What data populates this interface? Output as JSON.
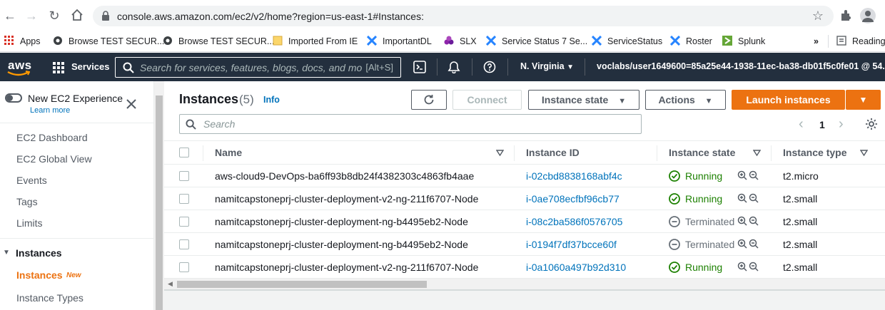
{
  "browser": {
    "url": "console.aws.amazon.com/ec2/v2/home?region=us-east-1#Instances:",
    "bookmarks": [
      "Apps",
      "Browse TEST SECUR...",
      "Browse TEST SECUR...",
      "Imported From IE",
      "ImportantDL",
      "SLX",
      "Service Status 7 Se...",
      "ServiceStatus",
      "Roster",
      "Splunk"
    ],
    "overflow": "»",
    "reading_list": "Reading"
  },
  "aws_header": {
    "logo": "aws",
    "services": "Services",
    "search_placeholder": "Search for services, features, blogs, docs, and mo",
    "search_shortcut": "[Alt+S]",
    "region": "N. Virginia",
    "account": "voclabs/user1649600=85a25e44-1938-11ec-ba38-db01f5c0fe01 @ 54..."
  },
  "sidebar": {
    "toggle_label": "New EC2 Experience",
    "learn_more": "Learn more",
    "items": [
      "EC2 Dashboard",
      "EC2 Global View",
      "Events",
      "Tags",
      "Limits"
    ],
    "section": "Instances",
    "active_item": "Instances",
    "new_badge": "New",
    "next_item": "Instance Types"
  },
  "instances_panel": {
    "title": "Instances",
    "count": "(5)",
    "info": "Info",
    "connect": "Connect",
    "instance_state": "Instance state",
    "actions": "Actions",
    "launch": "Launch instances",
    "search_placeholder": "Search",
    "page": "1",
    "columns": [
      "Name",
      "Instance ID",
      "Instance state",
      "Instance type"
    ],
    "rows": [
      {
        "name": "aws-cloud9-DevOps-ba6ff93b8db24f4382303c4863fb4aae",
        "id": "i-02cbd8838168abf4c",
        "state": "Running",
        "type": "t2.micro"
      },
      {
        "name": "namitcapstoneprj-cluster-deployment-v2-ng-211f6707-Node",
        "id": "i-0ae708ecfbf96cb77",
        "state": "Running",
        "type": "t2.small"
      },
      {
        "name": "namitcapstoneprj-cluster-deployment-ng-b4495eb2-Node",
        "id": "i-08c2ba586f0576705",
        "state": "Terminated",
        "type": "t2.small"
      },
      {
        "name": "namitcapstoneprj-cluster-deployment-ng-b4495eb2-Node",
        "id": "i-0194f7df37bcce60f",
        "state": "Terminated",
        "type": "t2.small"
      },
      {
        "name": "namitcapstoneprj-cluster-deployment-v2-ng-211f6707-Node",
        "id": "i-0a1060a497b92d310",
        "state": "Running",
        "type": "t2.small"
      }
    ]
  },
  "colors": {
    "aws_nav": "#232f3e",
    "primary": "#ec7211",
    "link": "#0073bb",
    "running": "#1d8102",
    "terminated": "#687078"
  }
}
